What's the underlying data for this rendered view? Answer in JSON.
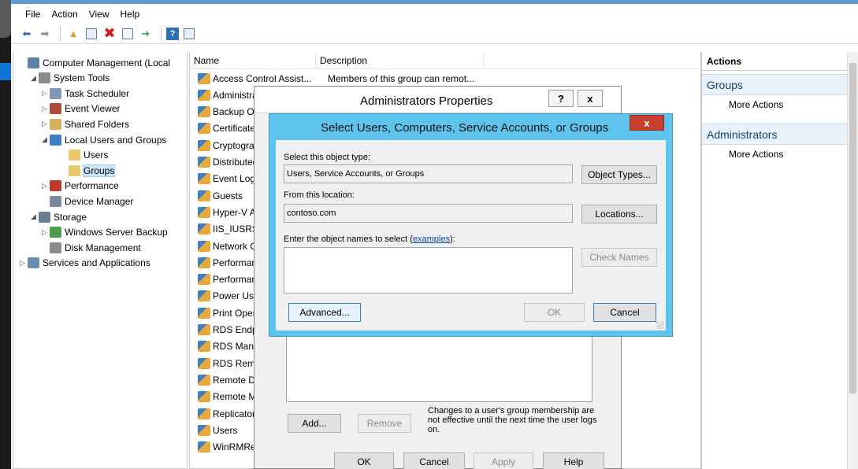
{
  "menu": [
    "File",
    "Action",
    "View",
    "Help"
  ],
  "tree": [
    {
      "label": "Computer Management (Local",
      "level": 0,
      "arrow": "",
      "color": "#5d7fa8"
    },
    {
      "label": "System Tools",
      "level": 1,
      "arrow": "◢",
      "color": "#8a8a8a"
    },
    {
      "label": "Task Scheduler",
      "level": 2,
      "arrow": "▷",
      "color": "#7f98b6"
    },
    {
      "label": "Event Viewer",
      "level": 2,
      "arrow": "▷",
      "color": "#b04a3a"
    },
    {
      "label": "Shared Folders",
      "level": 2,
      "arrow": "▷",
      "color": "#d6b15a"
    },
    {
      "label": "Local Users and Groups",
      "level": 2,
      "arrow": "◢",
      "color": "#3d7fc4"
    },
    {
      "label": "Users",
      "level": 3,
      "arrow": "",
      "color": "#e8c96a"
    },
    {
      "label": "Groups",
      "level": 3,
      "arrow": "",
      "color": "#e8c96a",
      "selected": true
    },
    {
      "label": "Performance",
      "level": 2,
      "arrow": "▷",
      "color": "#c0392b"
    },
    {
      "label": "Device Manager",
      "level": 2,
      "arrow": "",
      "color": "#7a8a9a"
    },
    {
      "label": "Storage",
      "level": 1,
      "arrow": "◢",
      "color": "#6a7d92"
    },
    {
      "label": "Windows Server Backup",
      "level": 2,
      "arrow": "▷",
      "color": "#4aa04a"
    },
    {
      "label": "Disk Management",
      "level": 2,
      "arrow": "",
      "color": "#8a8a8a"
    },
    {
      "label": "Services and Applications",
      "level": 1,
      "arrow": "▷",
      "color": "#6a8fb4",
      "nolevel": true
    }
  ],
  "list": {
    "col_name": "Name",
    "col_desc": "Description",
    "rows": [
      {
        "name": "Access Control Assist...",
        "desc": "Members of this group can remot..."
      },
      {
        "name": "Administrato",
        "desc": ""
      },
      {
        "name": "Backup Oper",
        "desc": ""
      },
      {
        "name": "Certificate Se",
        "desc": ""
      },
      {
        "name": "Cryptograph",
        "desc": ""
      },
      {
        "name": "Distributed C",
        "desc": ""
      },
      {
        "name": "Event Log Re",
        "desc": ""
      },
      {
        "name": "Guests",
        "desc": ""
      },
      {
        "name": "Hyper-V Adn",
        "desc": ""
      },
      {
        "name": "IIS_IUSRS",
        "desc": ""
      },
      {
        "name": "Network Cor",
        "desc": ""
      },
      {
        "name": "Performance",
        "desc": ""
      },
      {
        "name": "Performance",
        "desc": ""
      },
      {
        "name": "Power Users",
        "desc": ""
      },
      {
        "name": "Print Operato",
        "desc": ""
      },
      {
        "name": "RDS Endpoin",
        "desc": ""
      },
      {
        "name": "RDS Manage",
        "desc": ""
      },
      {
        "name": "RDS Remote",
        "desc": ""
      },
      {
        "name": "Remote Desk",
        "desc": ""
      },
      {
        "name": "Remote Man",
        "desc": ""
      },
      {
        "name": "Replicator",
        "desc": ""
      },
      {
        "name": "Users",
        "desc": ""
      },
      {
        "name": "WinRMRemo",
        "desc": ""
      }
    ]
  },
  "actions": {
    "header": "Actions",
    "section1": "Groups",
    "more1": "More Actions",
    "section2": "Administrators",
    "more2": "More Actions"
  },
  "props": {
    "title": "Administrators Properties",
    "help": "?",
    "close": "x",
    "add": "Add...",
    "remove": "Remove",
    "note": "Changes to a user's group membership are not effective until the next time the user logs on.",
    "ok": "OK",
    "cancel": "Cancel",
    "apply": "Apply",
    "help_btn": "Help"
  },
  "select": {
    "title": "Select Users, Computers, Service Accounts, or Groups",
    "close": "x",
    "type_label": "Select this object type:",
    "type_value": "Users, Service Accounts, or Groups",
    "object_types": "Object Types...",
    "loc_label": "From this location:",
    "loc_value": "contoso.com",
    "locations": "Locations...",
    "names_label_pre": "Enter the object names to select (",
    "names_label_link": "examples",
    "names_label_post": "):",
    "check_names": "Check Names",
    "advanced": "Advanced...",
    "ok": "OK",
    "cancel": "Cancel"
  }
}
